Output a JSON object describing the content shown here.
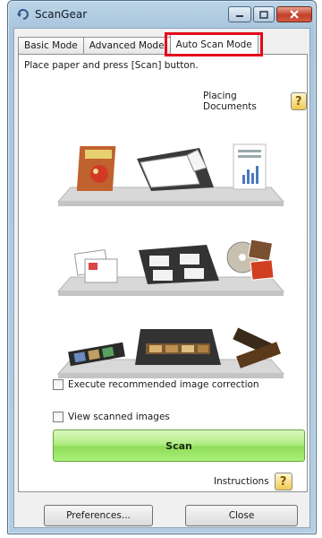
{
  "window": {
    "title": "ScanGear"
  },
  "tabs": [
    {
      "label": "Basic Mode"
    },
    {
      "label": "Advanced Mode"
    },
    {
      "label": "Auto Scan Mode"
    }
  ],
  "panel": {
    "instruction": "Place paper and press [Scan] button.",
    "placing_documents_label": "Placing Documents",
    "checkboxes": [
      {
        "label": "Execute recommended image correction",
        "checked": false
      },
      {
        "label": "View scanned images",
        "checked": false
      }
    ],
    "scan_label": "Scan",
    "instructions_label": "Instructions"
  },
  "footer": {
    "preferences_label": "Preferences...",
    "close_label": "Close"
  },
  "colors": {
    "tab_highlight": "#e3091a",
    "scan_button": "#a6ea7a"
  },
  "icons": [
    "scangear-app-icon",
    "minimize-icon",
    "maximize-icon",
    "close-window-icon",
    "help-icon"
  ]
}
